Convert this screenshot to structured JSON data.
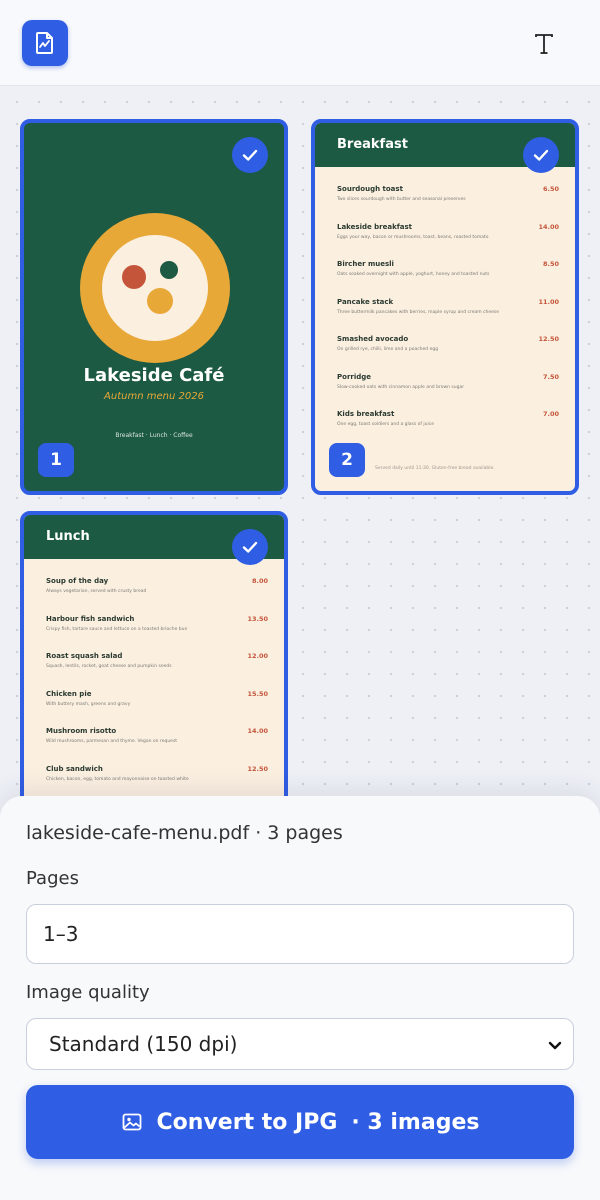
{
  "toolbar": {
    "app_icon": "pdf-chart-document-icon",
    "text_tool_icon": "text-tool-icon",
    "accent": "#2f5de3"
  },
  "pages": [
    {
      "number": "1",
      "selected": true,
      "kind": "cover",
      "title": "Lakeside Café",
      "subtitle": "Autumn menu 2026",
      "footer": "Breakfast · Lunch · Coffee"
    },
    {
      "number": "2",
      "selected": true,
      "kind": "menu",
      "heading": "Breakfast",
      "items": [
        {
          "name": "Sourdough toast",
          "desc": "Two slices sourdough with butter and seasonal preserves",
          "price": "6.50"
        },
        {
          "name": "Lakeside breakfast",
          "desc": "Eggs your way, bacon or mushrooms, toast, beans, roasted tomato",
          "price": "14.00"
        },
        {
          "name": "Bircher muesli",
          "desc": "Oats soaked overnight with apple, yoghurt, honey and toasted nuts",
          "price": "8.50"
        },
        {
          "name": "Pancake stack",
          "desc": "Three buttermilk pancakes with berries, maple syrup and cream cheese",
          "price": "11.00"
        },
        {
          "name": "Smashed avocado",
          "desc": "On grilled rye, chilli, lime and a poached egg",
          "price": "12.50"
        },
        {
          "name": "Porridge",
          "desc": "Slow-cooked oats with cinnamon apple and brown sugar",
          "price": "7.50"
        },
        {
          "name": "Kids breakfast",
          "desc": "One egg, toast soldiers and a glass of juice",
          "price": "7.00"
        }
      ],
      "footer": "Served daily until 11:30. Gluten-free bread available."
    },
    {
      "number": "3",
      "selected": true,
      "kind": "menu",
      "heading": "Lunch",
      "items": [
        {
          "name": "Soup of the day",
          "desc": "Always vegetarian, served with crusty bread",
          "price": "8.00"
        },
        {
          "name": "Harbour fish sandwich",
          "desc": "Crispy fish, tartare sauce and lettuce on a toasted brioche bun",
          "price": "13.50"
        },
        {
          "name": "Roast squash salad",
          "desc": "Squash, lentils, rocket, goat cheese and pumpkin seeds",
          "price": "12.00"
        },
        {
          "name": "Chicken pie",
          "desc": "With buttery mash, greens and gravy",
          "price": "15.50"
        },
        {
          "name": "Mushroom risotto",
          "desc": "Wild mushrooms, parmesan and thyme. Vegan on request",
          "price": "14.00"
        },
        {
          "name": "Club sandwich",
          "desc": "Chicken, bacon, egg, tomato and mayonnaise on toasted white",
          "price": "12.50"
        }
      ]
    }
  ],
  "sheet": {
    "file_info": "lakeside-cafe-menu.pdf · 3 pages",
    "pages_label": "Pages",
    "pages_value": "1–3",
    "quality_label": "Image quality",
    "quality_value": "Standard (150 dpi)",
    "convert_label": "Convert to JPG",
    "convert_count": "· 3 images",
    "convert_icon": "image-icon"
  }
}
